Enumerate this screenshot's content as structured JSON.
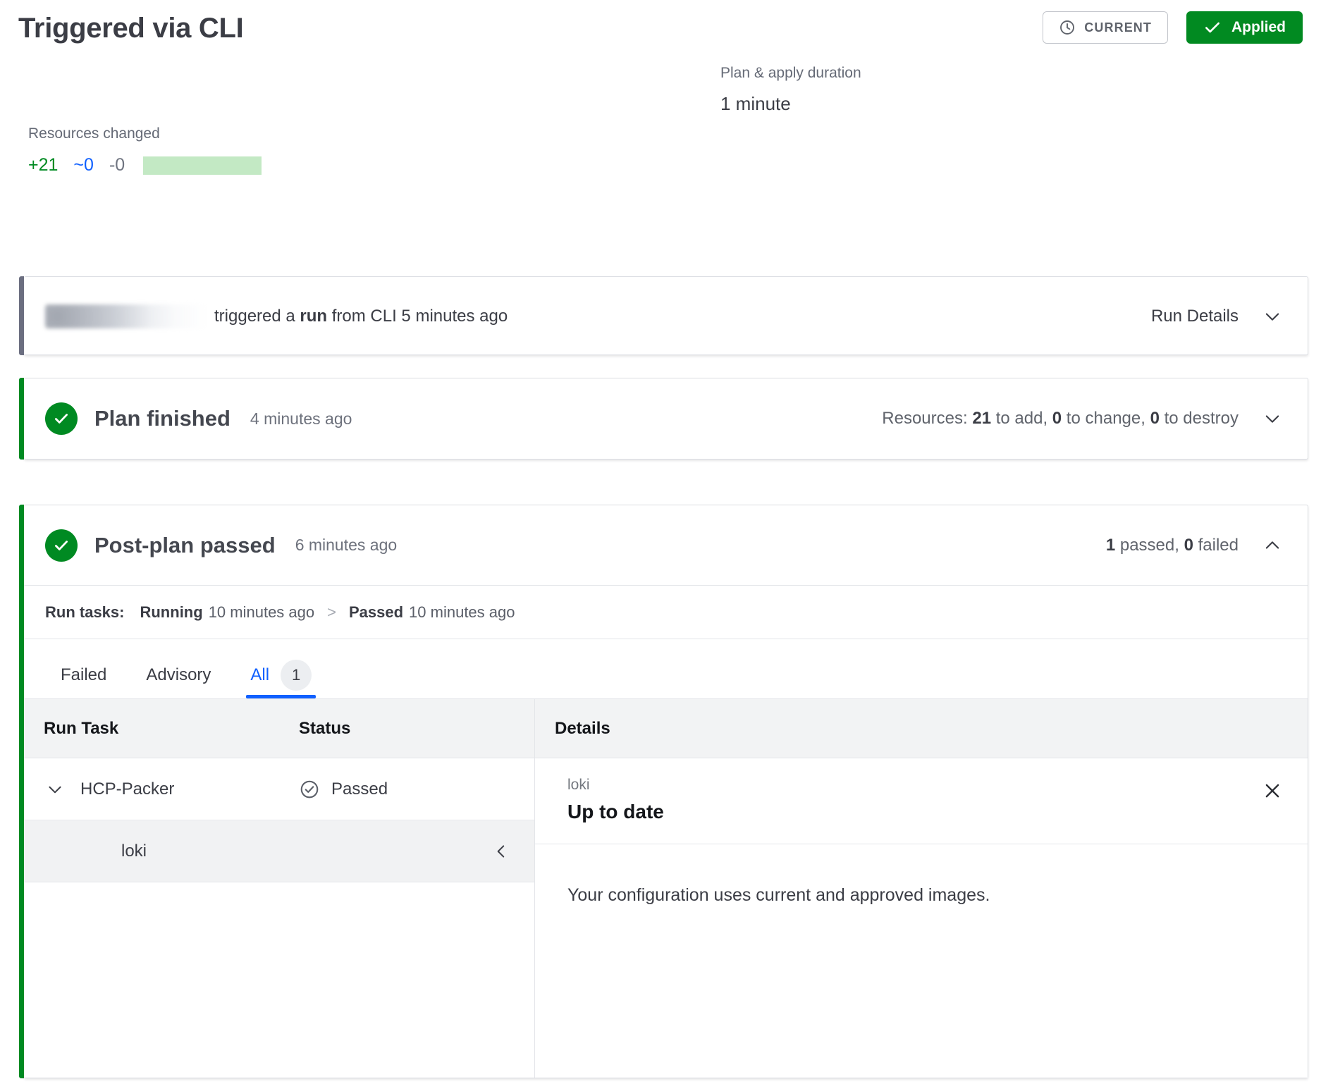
{
  "header": {
    "title": "Triggered via CLI",
    "current_badge": "CURRENT",
    "applied_badge": "Applied",
    "clock_icon": "clock-icon",
    "check_icon": "check-icon"
  },
  "stats": {
    "duration_label": "Plan & apply duration",
    "duration_value": "1 minute",
    "resources_label": "Resources changed",
    "added": "+21",
    "changed": "~0",
    "destroyed": "-0",
    "bar_color": "#c3e9c4",
    "added_color": "#008a22",
    "changed_color": "#1060ff",
    "destroyed_color": "#6f7480"
  },
  "run_card": {
    "text_prefix": "triggered a ",
    "text_bold": "run",
    "text_suffix": " from CLI 5 minutes ago",
    "run_details_label": "Run Details",
    "chevron_icon": "chevron-down-icon",
    "accent_color": "#6b6e80"
  },
  "plan_card": {
    "title": "Plan finished",
    "time": "4 minutes ago",
    "resources_prefix": "Resources: ",
    "add_count": "21",
    "add_text": " to add, ",
    "change_count": "0",
    "change_text": " to change, ",
    "destroy_count": "0",
    "destroy_text": " to destroy",
    "chevron_icon": "chevron-down-icon",
    "accent_color": "#008a22"
  },
  "postplan_card": {
    "title": "Post-plan passed",
    "time": "6 minutes ago",
    "passed_count": "1",
    "passed_text": " passed, ",
    "failed_count": "0",
    "failed_text": " failed",
    "chevron_icon": "chevron-up-icon",
    "accent_color": "#008a22",
    "run_tasks": {
      "label": "Run tasks:",
      "first_status": "Running",
      "first_time": "10 minutes ago",
      "separator": ">",
      "second_status": "Passed",
      "second_time": "10 minutes ago"
    },
    "tabs": [
      {
        "label": "Failed",
        "active": false
      },
      {
        "label": "Advisory",
        "active": false
      },
      {
        "label": "All",
        "active": true,
        "count": "1"
      }
    ],
    "table": {
      "columns": [
        "Run Task",
        "Status",
        "Details"
      ],
      "rows": [
        {
          "name": "HCP-Packer",
          "status": "Passed",
          "status_icon": "check-circle-outline-icon",
          "expand_icon": "chevron-down-icon",
          "children": [
            {
              "name": "loki",
              "collapse_icon": "chevron-left-icon"
            }
          ]
        }
      ]
    },
    "detail": {
      "eyebrow": "loki",
      "title": "Up to date",
      "body": "Your configuration uses current and approved images.",
      "close_icon": "close-icon"
    }
  }
}
